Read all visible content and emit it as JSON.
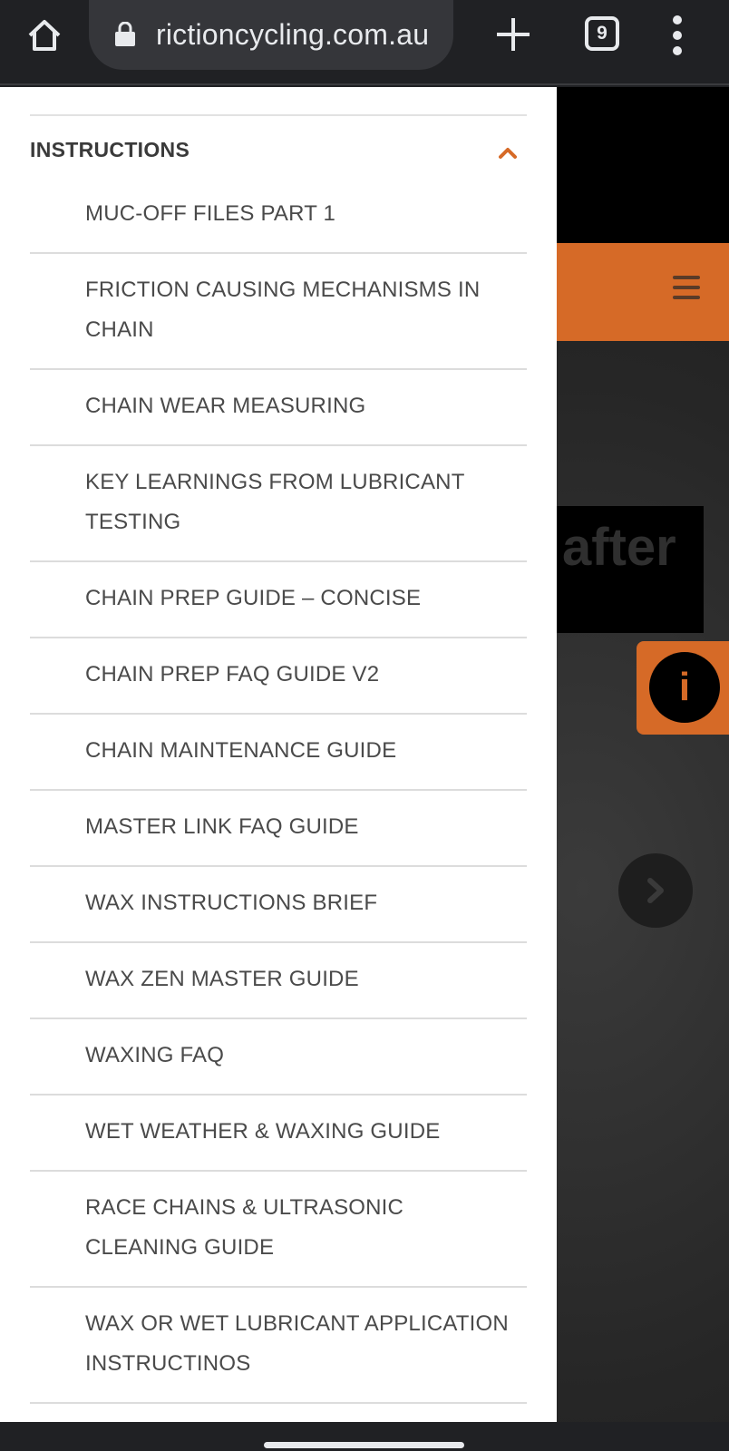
{
  "browser": {
    "url": "rictioncycling.com.au",
    "tab_count": "9",
    "icons": {
      "home": "home-icon",
      "lock": "lock-icon",
      "new_tab": "plus-icon",
      "tabs": "tab-switcher-icon",
      "menu": "more-vert-icon"
    }
  },
  "background_page": {
    "hero_text": "after",
    "icons": {
      "hamburger": "hamburger-icon",
      "info": "info-icon",
      "next": "chevron-right-icon"
    },
    "info_glyph": "i",
    "accent_color": "#d66a27"
  },
  "drawer": {
    "section_title": "INSTRUCTIONS",
    "section_icon": "chevron-up-icon",
    "items": [
      "MUC-OFF FILES PART 1",
      "FRICTION CAUSING MECHANISMS IN CHAIN",
      "CHAIN WEAR MEASURING",
      "KEY LEARNINGS FROM LUBRICANT TESTING",
      "CHAIN PREP GUIDE – CONCISE",
      "CHAIN PREP FAQ GUIDE V2",
      "CHAIN MAINTENANCE GUIDE",
      "MASTER LINK FAQ GUIDE",
      "WAX INSTRUCTIONS BRIEF",
      "WAX ZEN MASTER GUIDE",
      "WAXING FAQ",
      "WET WEATHER & WAXING GUIDE",
      "RACE CHAINS & ULTRASONIC CLEANING GUIDE",
      "WAX OR WET LUBRICANT APPLICATION INSTRUCTINOS"
    ]
  }
}
